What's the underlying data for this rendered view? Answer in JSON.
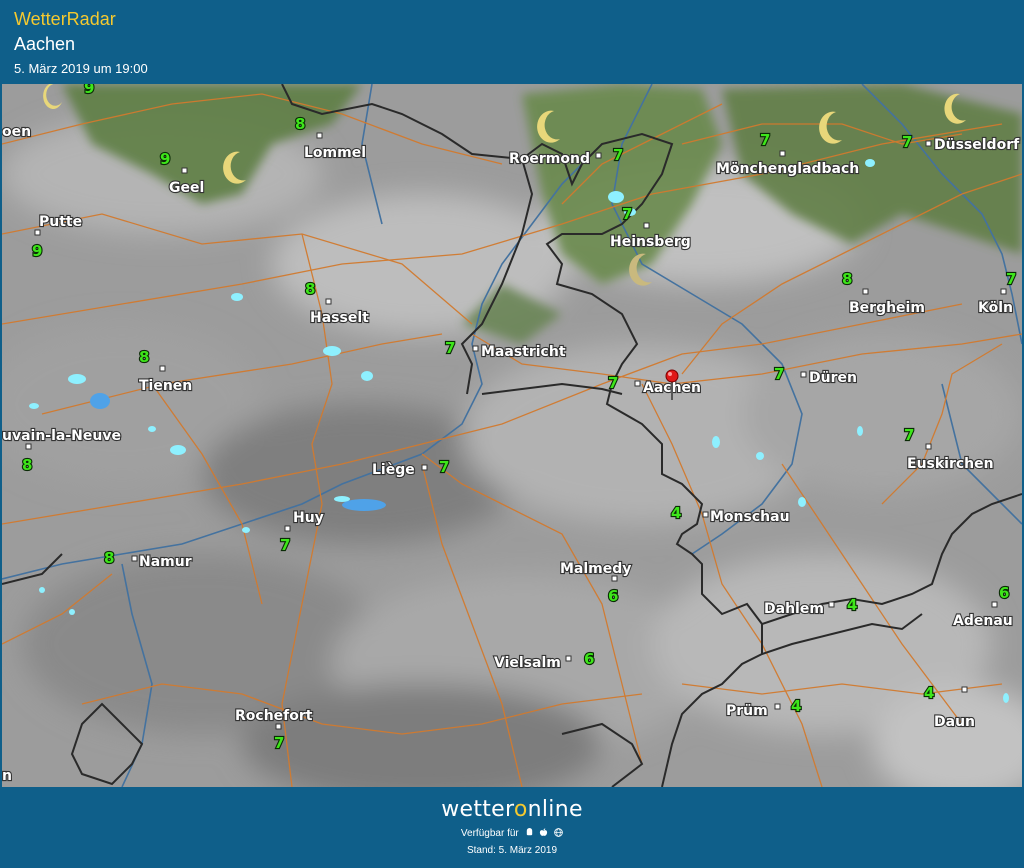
{
  "header": {
    "app_title": "WetterRadar",
    "location": "Aachen",
    "datetime": "5. März 2019 um 19:00"
  },
  "footer": {
    "brand_part1": "wetter",
    "brand_o": "o",
    "brand_part2": "nline",
    "available": "Verfügbar für",
    "platform_icons": [
      "android-icon",
      "apple-icon",
      "web-icon"
    ],
    "stand": "Stand: 5. März 2019"
  },
  "colors": {
    "header_bg": "#0f5f8a",
    "title": "#f5c92f",
    "temperature": "#3ee61a",
    "roads": "#d27a2e",
    "borders": "#2b2b2b",
    "rivers": "#3f6f9f",
    "clouds": "#a9a9a9",
    "vegetation": "#6b8a4f",
    "precipitation": "#7fe6ff"
  },
  "map": {
    "marker": "location-pin-icon",
    "cities": [
      {
        "name": "Lommel",
        "temp": "8"
      },
      {
        "name": "Roermond",
        "temp": "7"
      },
      {
        "name": "Mönchengladbach",
        "temp": "7"
      },
      {
        "name": "Düsseldorf",
        "temp": "7"
      },
      {
        "name": "Geel",
        "temp": "9"
      },
      {
        "name": "Putte",
        "temp": "9"
      },
      {
        "name": "Heinsberg",
        "temp": "7"
      },
      {
        "name": "Hasselt",
        "temp": "8"
      },
      {
        "name": "Bergheim",
        "temp": "8"
      },
      {
        "name": "Köln",
        "temp": "7"
      },
      {
        "name": "Maastricht",
        "temp": "7"
      },
      {
        "name": "Tienen",
        "temp": "8"
      },
      {
        "name": "Aachen",
        "temp": "7"
      },
      {
        "name": "Düren",
        "temp": "7"
      },
      {
        "name": "Louvain-la-Neuve",
        "temp": "8"
      },
      {
        "name": "Euskirchen",
        "temp": "7"
      },
      {
        "name": "Liège",
        "temp": "7"
      },
      {
        "name": "Huy",
        "temp": "7"
      },
      {
        "name": "Monschau",
        "temp": "4"
      },
      {
        "name": "Namur",
        "temp": "8"
      },
      {
        "name": "Malmedy",
        "temp": "6"
      },
      {
        "name": "Dahlem",
        "temp": "4"
      },
      {
        "name": "Adenau",
        "temp": "6"
      },
      {
        "name": "Vielsalm",
        "temp": "6"
      },
      {
        "name": "Prüm",
        "temp": "4"
      },
      {
        "name": "Daun",
        "temp": "4"
      },
      {
        "name": "Rochefort",
        "temp": "7"
      }
    ],
    "edge_labels": [
      "oen",
      "uvain-la-Neuve",
      "9",
      "n"
    ]
  }
}
